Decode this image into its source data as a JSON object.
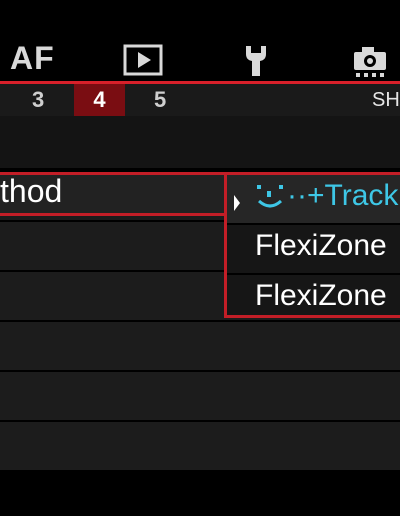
{
  "tabs": {
    "af_label": "AF",
    "playback_icon": "play-icon",
    "setup_icon": "wrench-icon",
    "custom_icon": "camera-settings-icon"
  },
  "subtabs": {
    "items": [
      "3",
      "4",
      "5"
    ],
    "active": "4",
    "section_label": "SHO"
  },
  "menu": {
    "selected_item_label": "thod"
  },
  "popup": {
    "options": [
      "··+Tracki",
      "FlexiZone",
      "FlexiZone"
    ],
    "selected_index": 0
  },
  "colors": {
    "accent": "#c31e27",
    "active_tab": "#7a0d12",
    "highlight_text": "#3ec7e6"
  }
}
